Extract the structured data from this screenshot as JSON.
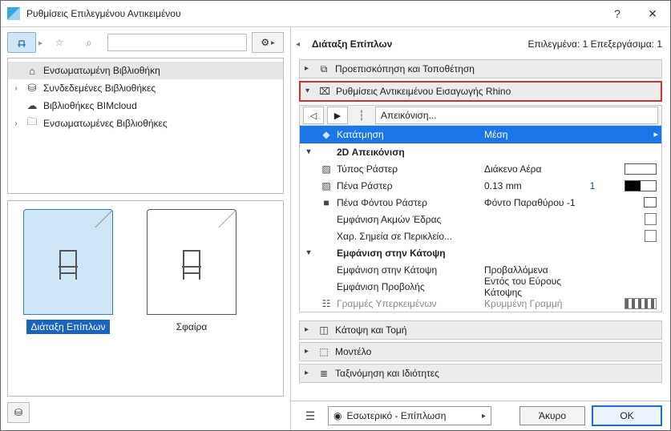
{
  "window": {
    "title": "Ρυθμίσεις Επιλεγμένου Αντικειμένου",
    "help": "?",
    "close": "✕"
  },
  "left": {
    "search_placeholder": "",
    "tree": [
      {
        "indent": 0,
        "arrow": "",
        "icon": "⌂",
        "label": "Ενσωματωμένη Βιβλιοθήκη",
        "selected": true
      },
      {
        "indent": 0,
        "arrow": "›",
        "icon": "⛁",
        "label": "Συνδεδεμένες Βιβλιοθήκες",
        "selected": false
      },
      {
        "indent": 0,
        "arrow": "",
        "icon": "☁",
        "label": "Βιβλιοθήκες BIMcloud",
        "selected": false
      },
      {
        "indent": 0,
        "arrow": "›",
        "icon": "🗀",
        "label": "Ενσωματωμένες Βιβλιοθήκες",
        "selected": false
      }
    ],
    "thumbs": [
      {
        "label": "Διάταξη Επίπλων",
        "selected": true
      },
      {
        "label": "Σφαίρα",
        "selected": false
      }
    ]
  },
  "right": {
    "title": "Διάταξη Επίπλων",
    "status": "Επιλεγμένα: 1 Επεξεργάσιμα: 1",
    "panels_top": [
      {
        "arrow": "▸",
        "icon": "⧉",
        "label": "Προεπισκόπηση και Τοποθέτηση",
        "highlight": false
      },
      {
        "arrow": "▾",
        "icon": "⌧",
        "label": "Ρυθμίσεις Αντικειμένου Εισαγωγής Rhino",
        "highlight": true
      }
    ],
    "prop_toolbar": {
      "back": "◁",
      "fwd": "▶",
      "split": "┆",
      "dropdown": "Απεικόνιση..."
    },
    "header_row": {
      "key": "Κατάτμηση",
      "val": "Μέση"
    },
    "rows": [
      {
        "type": "section",
        "arrow": "▾",
        "key": "2D Απεικόνιση"
      },
      {
        "type": "prop",
        "icon": "▨",
        "key": "Τύπος Ράστερ",
        "val": "Διάκενο Αέρα",
        "swatch": "blank"
      },
      {
        "type": "prop",
        "icon": "▧",
        "key": "Πένα Ράστερ",
        "val": "0.13 mm",
        "num": "1",
        "swatch": "half"
      },
      {
        "type": "prop",
        "icon": "■",
        "key": "Πένα Φόντου Ράστερ",
        "val": "Φόντο Παραθύρου -1",
        "swatch": "screen"
      },
      {
        "type": "check",
        "key": "Εμφάνιση Ακμών Έδρας"
      },
      {
        "type": "check",
        "key": "Χαρ. Σημεία σε Περικλείο..."
      },
      {
        "type": "section",
        "arrow": "▾",
        "key": "Εμφάνιση στην Κάτοψη"
      },
      {
        "type": "prop",
        "key": "Εμφάνιση στην Κάτοψη",
        "val": "Προβαλλόμενα"
      },
      {
        "type": "prop",
        "key": "Εμφάνιση Προβολής",
        "val": "Εντός του Εύρους Κάτοψης"
      },
      {
        "type": "grey",
        "icon": "☷",
        "key": "Γραμμές Υπερκειμένων",
        "val": "Κρυμμένη Γραμμή",
        "swatch": "dash"
      }
    ],
    "panels_bottom": [
      {
        "arrow": "▸",
        "icon": "◫",
        "label": "Κάτοψη και Τομή"
      },
      {
        "arrow": "▸",
        "icon": "⬚",
        "label": "Μοντέλο"
      },
      {
        "arrow": "▸",
        "icon": "≣",
        "label": "Ταξινόμηση και Ιδιότητες"
      }
    ]
  },
  "footer": {
    "combo": "Εσωτερικό - Επίπλωση",
    "cancel": "Άκυρο",
    "ok": "OK"
  }
}
